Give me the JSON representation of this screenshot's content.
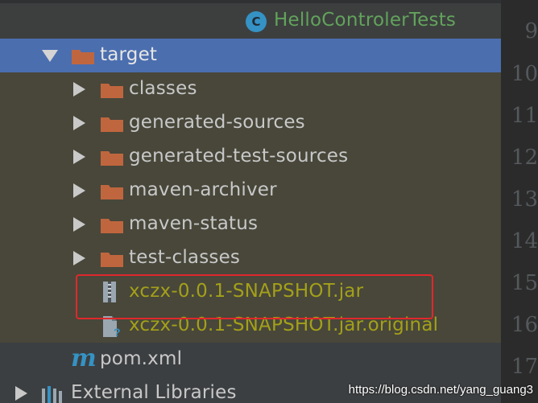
{
  "tree": {
    "header_item": "HelloControlerTests",
    "target": "target",
    "folders": [
      "classes",
      "generated-sources",
      "generated-test-sources",
      "maven-archiver",
      "maven-status",
      "test-classes"
    ],
    "jar": "xczx-0.0.1-SNAPSHOT.jar",
    "jar_original": "xczx-0.0.1-SNAPSHOT.jar.original",
    "pom": "pom.xml",
    "external_libraries": "External Libraries"
  },
  "gutter": {
    "line_numbers": [
      "9",
      "10",
      "11",
      "12",
      "13",
      "14",
      "15",
      "16",
      "17"
    ]
  },
  "watermark": "https://blog.csdn.net/yang_guang3",
  "colors": {
    "selection": "#4b6eaf",
    "highlight_box": "#e0282b",
    "folder": "#c0663e",
    "modified_text": "#a4a019",
    "test_text": "#62a35b"
  }
}
